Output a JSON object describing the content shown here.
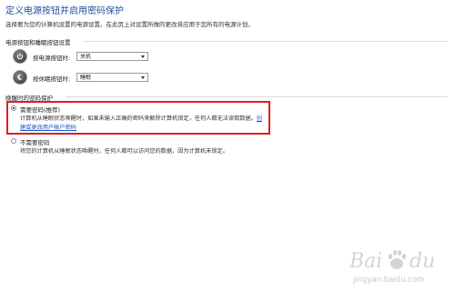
{
  "header": {
    "title": "定义电源按钮并启用密码保护",
    "description": "选择要为您的计算机设置的电源设置。在此页上对设置所做的更改将应用于您所有的电源计划。"
  },
  "power_section": {
    "title": "电源按钮和睡眠按钮设置",
    "power_button": {
      "label": "按电源按钮时:",
      "value": "关机",
      "icon": "power-icon"
    },
    "sleep_button": {
      "label": "按休眠按钮时:",
      "value": "睡眠",
      "icon": "moon-icon"
    }
  },
  "password_section": {
    "title": "唤醒时的密码保护",
    "require": {
      "label": "需要密码(推荐)",
      "desc": "计算机从睡眠状态唤醒时，如果未输入正确的密码来解除计算机锁定，任何人都无法读取数据。",
      "link_part1": "创",
      "link_part2": "建或更改用户帐户密码",
      "checked": true
    },
    "no_require": {
      "label": "不需要密码",
      "desc": "将您的计算机从睡眠状态唤醒时，任何人都可以访问您的数据，因为计算机未锁定。",
      "checked": false
    }
  },
  "colors": {
    "title": "#1f4e9a",
    "highlight": "#e01e1e",
    "link": "#1a55c9"
  },
  "watermark": {
    "line1": "Bai",
    "line2": "du",
    "sub": "jingyan.baidu.com"
  }
}
